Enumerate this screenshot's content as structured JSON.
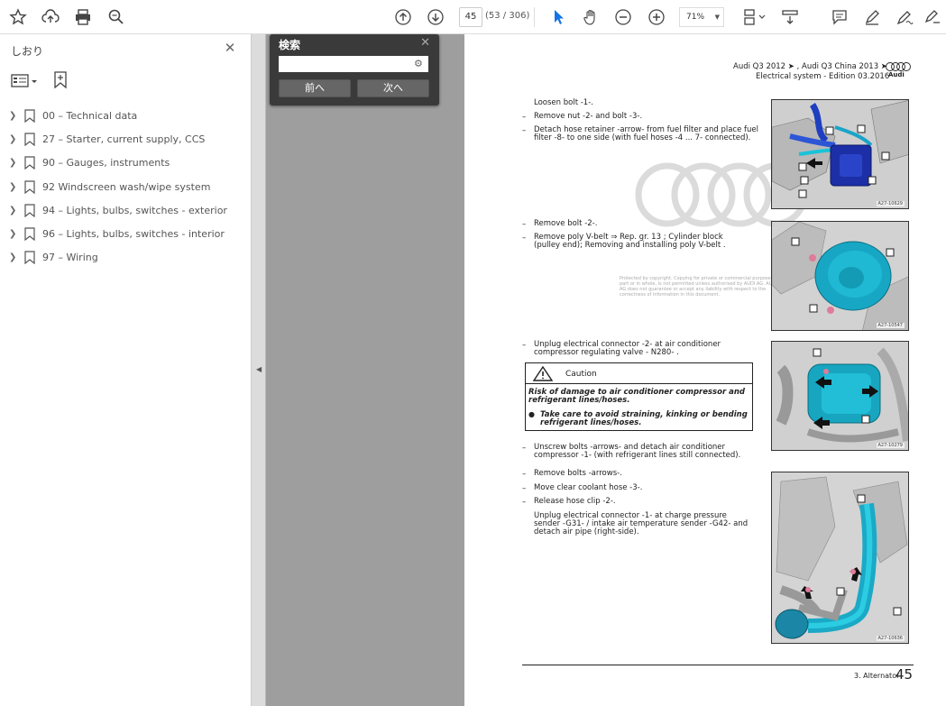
{
  "toolbar": {
    "page_current": "45",
    "page_total": "(53 / 306)",
    "zoom": "71%"
  },
  "sidebar": {
    "title": "しおり",
    "close": "✕",
    "bookmarks": [
      {
        "label": "00 – Technical data"
      },
      {
        "label": "27 – Starter, current supply, CCS"
      },
      {
        "label": "90 – Gauges, instruments"
      },
      {
        "label": "92    Windscreen wash/wipe system"
      },
      {
        "label": "94 – Lights, bulbs, switches - exterior"
      },
      {
        "label": "96 – Lights, bulbs, switches - interior"
      },
      {
        "label": "97 – Wiring"
      }
    ]
  },
  "find": {
    "title": "検索",
    "close": "✕",
    "prev": "前へ",
    "next": "次へ"
  },
  "page": {
    "header_line1": "Audi Q3 2012 ➤ , Audi Q3 China 2013 ➤",
    "header_line2": "Electrical system - Edition 03.2016",
    "logo_text": "Audi",
    "steps": [
      {
        "dash": "–",
        "text": "Loosen bolt -1-."
      },
      {
        "dash": "–",
        "text": "Remove nut -2- and bolt -3-."
      },
      {
        "dash": "–",
        "text": "Detach hose retainer -arrow- from fuel filter and place fuel filter -8- to one side (with fuel hoses -4 ... 7- connected)."
      },
      {
        "dash": "–",
        "text": "Remove bolt -2-."
      },
      {
        "dash": "–",
        "text": "Remove poly V-belt ⇒ Rep. gr. 13 ; Cylinder block (pulley end); Removing and installing poly V-belt ."
      },
      {
        "dash": "–",
        "text": "Unplug electrical connector -2- at air conditioner compressor regulating valve - N280- ."
      },
      {
        "dash": "–",
        "text": "Unscrew bolts -arrows- and detach air conditioner compressor -1- (with refrigerant lines still connected)."
      },
      {
        "dash": "–",
        "text": "Remove bolts -arrows-."
      },
      {
        "dash": "–",
        "text": "Move clear coolant hose -3-."
      },
      {
        "dash": "–",
        "text": "Release hose clip -2-."
      },
      {
        "dash": "–",
        "text": "Unplug electrical connector -1- at charge pressure sender -G31- / intake air temperature sender -G42- and detach air pipe (right-side)."
      }
    ],
    "caution_title": "Caution",
    "caution_text": "Risk of damage to air conditioner compressor and refrigerant lines/hoses.",
    "caution_bullet": "Take care to avoid straining, kinking or bending refrigerant lines/hoses.",
    "watermark_text": "Protected by copyright. Copying for private or commercial purposes, in part or in whole, is not permitted unless authorised by AUDI AG. AUDI AG does not guarantee or accept any liability with respect to the correctness of information in this document.",
    "fig_codes": [
      "A27-10629",
      "A27-10547",
      "A27-10279",
      "A27-10636"
    ],
    "footer_text": "3. Alternator",
    "footer_num": "45"
  }
}
